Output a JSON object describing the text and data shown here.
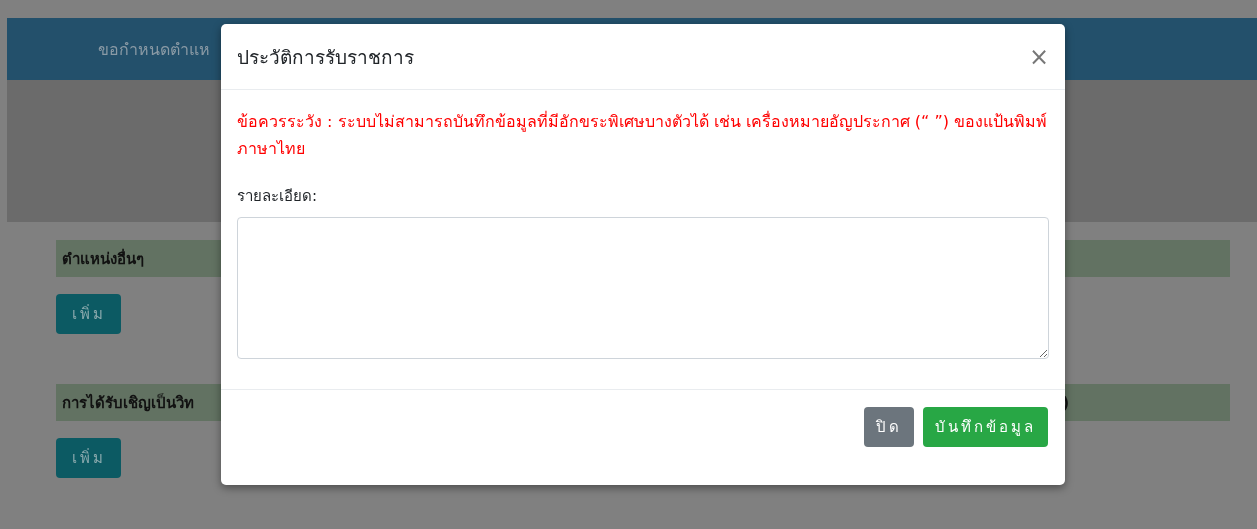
{
  "page": {
    "header_title": "ขอกำหนดตำแห",
    "sections": [
      {
        "title": "ตำแหน่งอื่นๆ",
        "button": "เพิ่ม"
      },
      {
        "title": "การได้รับเชิญเป็นวิท",
        "title_right": ")",
        "button": "เพิ่ม"
      }
    ]
  },
  "modal": {
    "title": "ประวัติการรับราชการ",
    "close": "×",
    "warning": "ข้อควรระวัง : ระบบไม่สามารถบันทึกข้อมูลที่มีอักขระพิเศษบางตัวได้ เช่น เครื่องหมายอัญประกาศ (“ ”) ของแป้นพิมพ์ภาษาไทย",
    "field_label": "รายละเอียด:",
    "buttons": [
      {
        "label": "ปิด",
        "kind": "secondary"
      },
      {
        "label": "บันทึกข้อมูล",
        "kind": "primary"
      }
    ]
  }
}
